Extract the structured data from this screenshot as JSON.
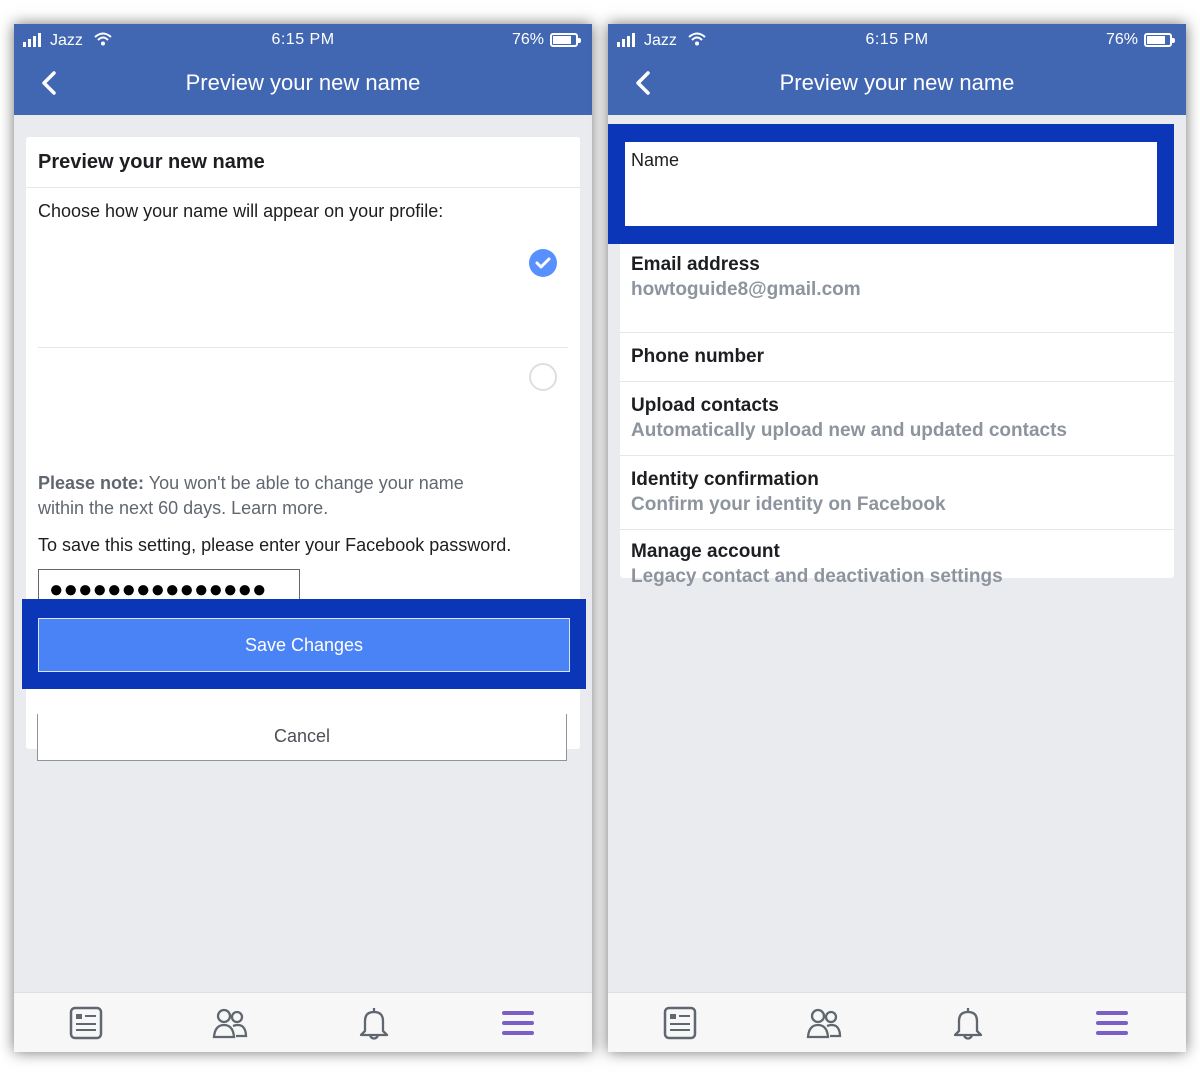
{
  "status": {
    "carrier": "Jazz",
    "time": "6:15 PM",
    "battery": "76%",
    "battery_level": 0.76
  },
  "header": {
    "title": "Preview your new name"
  },
  "left": {
    "card_title": "Preview your new name",
    "instruction": "Choose how your name will appear on your profile:",
    "note_label": "Please note:",
    "note_text_1": "You won't be able to change your name",
    "note_text_2": "within the next 60 days.",
    "learn_more": "Learn more.",
    "password_prompt": "To save this setting, please enter your Facebook password.",
    "password_value": "●●●●●●●●●●●●●●●",
    "save_label": "Save Changes",
    "cancel_label": "Cancel"
  },
  "right": {
    "name_label": "Name",
    "items": [
      {
        "title": "Email address",
        "subtitle": "howtoguide8@gmail.com"
      },
      {
        "title": "Phone number",
        "subtitle": ""
      },
      {
        "title": "Upload contacts",
        "subtitle": "Automatically upload new and updated contacts"
      },
      {
        "title": "Identity confirmation",
        "subtitle": "Confirm your identity on Facebook"
      },
      {
        "title": "Manage account",
        "subtitle": "Legacy contact and deactivation settings"
      }
    ]
  },
  "tabs": [
    {
      "icon": "news-feed-icon"
    },
    {
      "icon": "friends-icon"
    },
    {
      "icon": "notifications-icon"
    },
    {
      "icon": "menu-icon"
    }
  ],
  "colors": {
    "header": "#4267b2",
    "highlight": "#0b36b8",
    "save_button": "#4a83f5",
    "menu_active": "#7b5fc7"
  }
}
